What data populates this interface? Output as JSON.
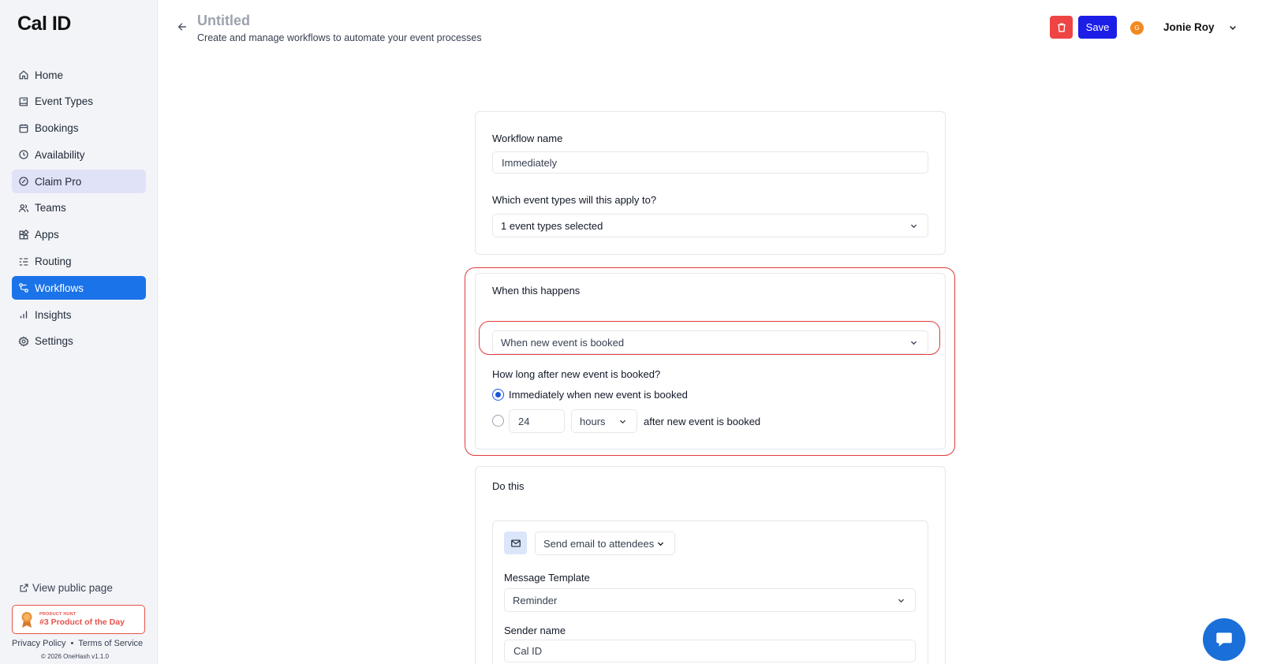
{
  "app": {
    "logo": "Cal ID"
  },
  "sidebar": {
    "items": [
      {
        "label": "Home",
        "icon": "home-icon"
      },
      {
        "label": "Event Types",
        "icon": "event-types-icon"
      },
      {
        "label": "Bookings",
        "icon": "calendar-icon"
      },
      {
        "label": "Availability",
        "icon": "clock-icon"
      },
      {
        "label": "Claim Pro",
        "icon": "badge-icon"
      },
      {
        "label": "Teams",
        "icon": "users-icon"
      },
      {
        "label": "Apps",
        "icon": "apps-icon"
      },
      {
        "label": "Routing",
        "icon": "routing-icon"
      },
      {
        "label": "Workflows",
        "icon": "workflow-icon"
      },
      {
        "label": "Insights",
        "icon": "chart-icon"
      },
      {
        "label": "Settings",
        "icon": "gear-icon"
      }
    ],
    "active": "Workflows",
    "view_public": "View public page",
    "badge": {
      "small": "PRODUCT HUNT",
      "big": "#3 Product of the Day"
    },
    "footer": {
      "privacy": "Privacy Policy",
      "sep": "•",
      "terms": "Terms of Service",
      "copyright": "© 2026 OneHash v1.1.0"
    }
  },
  "header": {
    "title": "Untitled",
    "subtitle": "Create and manage workflows to automate your event processes",
    "save_label": "Save",
    "avatar_initial": "G",
    "user_name": "Jonie Roy"
  },
  "workflow": {
    "name_label": "Workflow name",
    "name_value": "Immediately",
    "event_types_label": "Which event types will this apply to?",
    "event_types_value": "1 event types selected"
  },
  "trigger": {
    "heading": "When this happens",
    "value": "When new event is booked",
    "timing_label": "How long after new event is booked?",
    "option_immediate": "Immediately when new event is booked",
    "amount": "24",
    "unit": "hours",
    "after_text": "after new event is booked"
  },
  "action": {
    "heading": "Do this",
    "action_value": "Send email to attendees",
    "template_label": "Message Template",
    "template_value": "Reminder",
    "sender_label": "Sender name",
    "sender_value": "Cal ID"
  },
  "colors": {
    "active_nav": "#1a73e8",
    "save": "#1d1de8",
    "delete": "#ef4444",
    "highlight": "#e23b3b",
    "avatar": "#f28a21"
  }
}
